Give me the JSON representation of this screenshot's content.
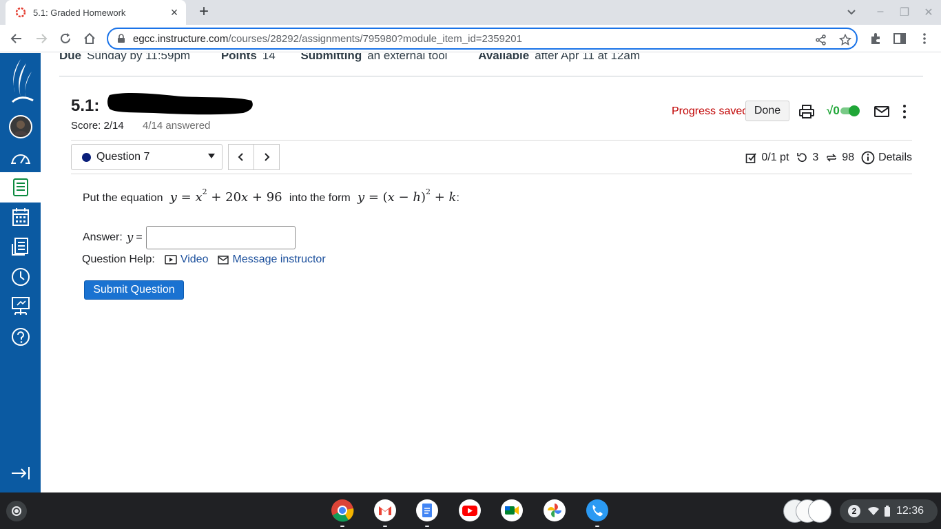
{
  "browser": {
    "tab_title": "5.1: Graded Homework",
    "url_host": "egcc.instructure.com",
    "url_path": "/courses/28292/assignments/795980?module_item_id=2359201"
  },
  "assignment_meta": {
    "due_label": "Due",
    "due_value": "Sunday by 11:59pm",
    "points_label": "Points",
    "points_value": "14",
    "submitting_label": "Submitting",
    "submitting_value": "an external tool",
    "available_label": "Available",
    "available_value": "after Apr 11 at 12am"
  },
  "homework": {
    "title_prefix": "5.1:",
    "score": "Score: 2/14",
    "answered": "4/14 answered",
    "progress_status": "Progress saved",
    "done_label": "Done",
    "sqrt_toggle_label": "√0"
  },
  "question_nav": {
    "selected_question": "Question 7",
    "points": "0/1 pt",
    "retries": "3",
    "attempts": "98",
    "details_label": "Details"
  },
  "question": {
    "prompt_prefix": "Put the equation",
    "prompt_mid": "into the form",
    "answer_label": "Answer:",
    "answer_var": "y",
    "answer_eq": "=",
    "answer_value": "",
    "help_label": "Question Help:",
    "video_label": "Video",
    "message_label": "Message instructor",
    "submit_label": "Submit Question"
  },
  "shelf": {
    "notification_count": "2",
    "time": "12:36"
  },
  "colors": {
    "sidebar": "#0b5aa2",
    "progress_saved": "#c00000",
    "submit_button": "#1a72d1",
    "link": "#1b4f9c",
    "toggle_on": "#1fa637"
  }
}
